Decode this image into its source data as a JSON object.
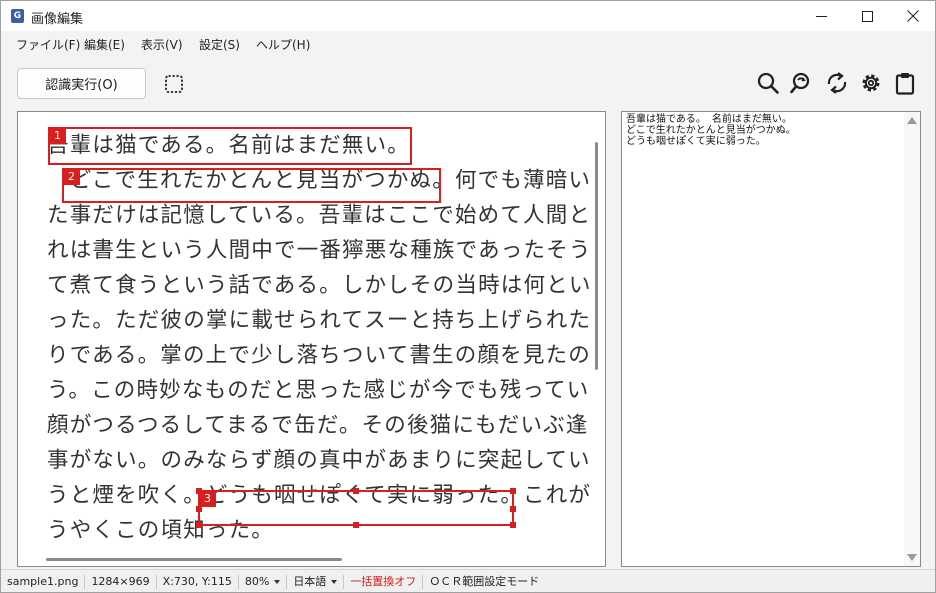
{
  "window": {
    "title": "画像編集",
    "app_icon_letter": "G"
  },
  "menu": [
    {
      "label": "ファイル(F)"
    },
    {
      "label": "編集(E)"
    },
    {
      "label": "表示(V)"
    },
    {
      "label": "設定(S)"
    },
    {
      "label": "ヘルプ(H)"
    }
  ],
  "toolbar": {
    "run_label": "認識実行(O)",
    "icons": [
      "select-region-icon",
      "search-icon",
      "search-replace-icon",
      "rotate-icon",
      "gear-icon",
      "clipboard-icon"
    ]
  },
  "document": {
    "lines": [
      "吾輩は猫である。名前はまだ無い。",
      "　どこで生れたかとんと見当がつかぬ。何でも薄暗い",
      "た事だけは記憶している。吾輩はここで始めて人間と",
      "れは書生という人間中で一番獰悪な種族であったそう",
      "て煮て食うという話である。しかしその当時は何とい",
      "った。ただ彼の掌に載せられてスーと持ち上げられた",
      "りである。掌の上で少し落ちついて書生の顔を見たの",
      "う。この時妙なものだと思った感じが今でも残ってい",
      "顔がつるつるしてまるで缶だ。その後猫にもだいぶ逢",
      "事がない。のみならず顔の真中があまりに突起してい",
      "うと煙を吹く。どうも咽せぽくて実に弱った。これが",
      "うやくこの頃知った。"
    ],
    "regions": [
      {
        "number": "1"
      },
      {
        "number": "2"
      },
      {
        "number": "3"
      }
    ]
  },
  "ocr_result": {
    "lines": [
      "吾輩は猫である。 名前はまだ無い。",
      "どこで生れたかとんと見当がつかぬ。",
      "どうも咽せぽくて実に弱った。"
    ]
  },
  "status": {
    "filename": "sample1.png",
    "dimensions": "1284×969",
    "coords": "X:730, Y:115",
    "zoom": "80%",
    "language": "日本語",
    "replace": "一括置換オフ",
    "mode": "ＯＣＲ範囲設定モード",
    "replace_color": "#d81e1e"
  }
}
